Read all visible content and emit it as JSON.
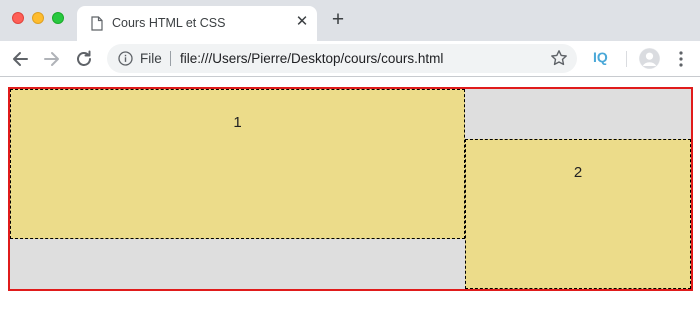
{
  "window": {
    "tab": {
      "title": "Cours HTML et CSS",
      "close_glyph": "✕",
      "icon": "document-icon"
    },
    "new_tab_glyph": "+"
  },
  "toolbar": {
    "back_icon": "arrow-left-icon",
    "forward_icon": "arrow-right-icon",
    "reload_icon": "reload-icon",
    "omnibox": {
      "info_icon": "info-icon",
      "scheme_label": "File",
      "url": "file:///Users/Pierre/Desktop/cours/cours.html",
      "bookmark_icon": "star-icon"
    },
    "extension_label": "IQ",
    "profile_icon": "avatar-icon",
    "menu_icon": "kebab-menu-icon"
  },
  "page": {
    "boxes": [
      {
        "label": "1"
      },
      {
        "label": "2"
      }
    ]
  },
  "colors": {
    "tabstrip": "#dee1e6",
    "outer_border": "#e01b1b",
    "outer_background": "#dedede",
    "box_background": "#ecdc8a",
    "extension_accent": "#4aa8d8"
  }
}
